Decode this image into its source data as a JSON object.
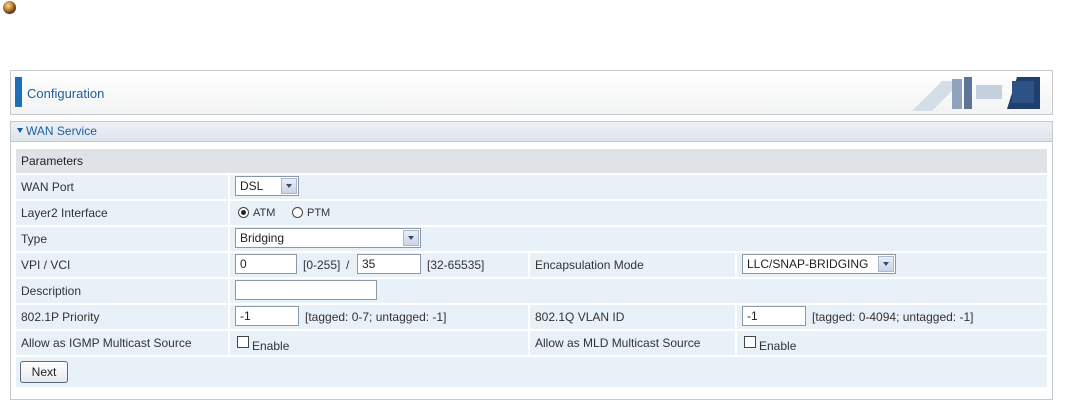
{
  "config": {
    "title": "Configuration"
  },
  "section": {
    "title": "WAN Service"
  },
  "params": {
    "heading": "Parameters"
  },
  "wan_port": {
    "label": "WAN Port",
    "value": "DSL"
  },
  "layer2": {
    "label": "Layer2 Interface",
    "options": [
      "ATM",
      "PTM"
    ],
    "selected": "ATM"
  },
  "type": {
    "label": "Type",
    "value": "Bridging"
  },
  "vpi_vci": {
    "label": "VPI / VCI",
    "vpi": "0",
    "vpi_range": "[0-255]",
    "sep": "/",
    "vci": "35",
    "vci_range": "[32-65535]"
  },
  "encap": {
    "label": "Encapsulation Mode",
    "value": "LLC/SNAP-BRIDGING"
  },
  "description": {
    "label": "Description",
    "value": ""
  },
  "priority": {
    "label": "802.1P Priority",
    "value": "-1",
    "hint": "[tagged: 0-7; untagged: -1]"
  },
  "vlan": {
    "label": "802.1Q VLAN ID",
    "value": "-1",
    "hint": "[tagged: 0-4094; untagged: -1]"
  },
  "igmp": {
    "label": "Allow as IGMP Multicast Source",
    "check_label": "Enable",
    "checked": false
  },
  "mld": {
    "label": "Allow as MLD Multicast Source",
    "check_label": "Enable",
    "checked": false
  },
  "next_button": {
    "label": "Next"
  },
  "colors": {
    "accent": "#1d6fb8",
    "header_text": "#1d5e9e",
    "row_bg": "#e8f0f8",
    "heading_bg": "#dfe3e8"
  }
}
